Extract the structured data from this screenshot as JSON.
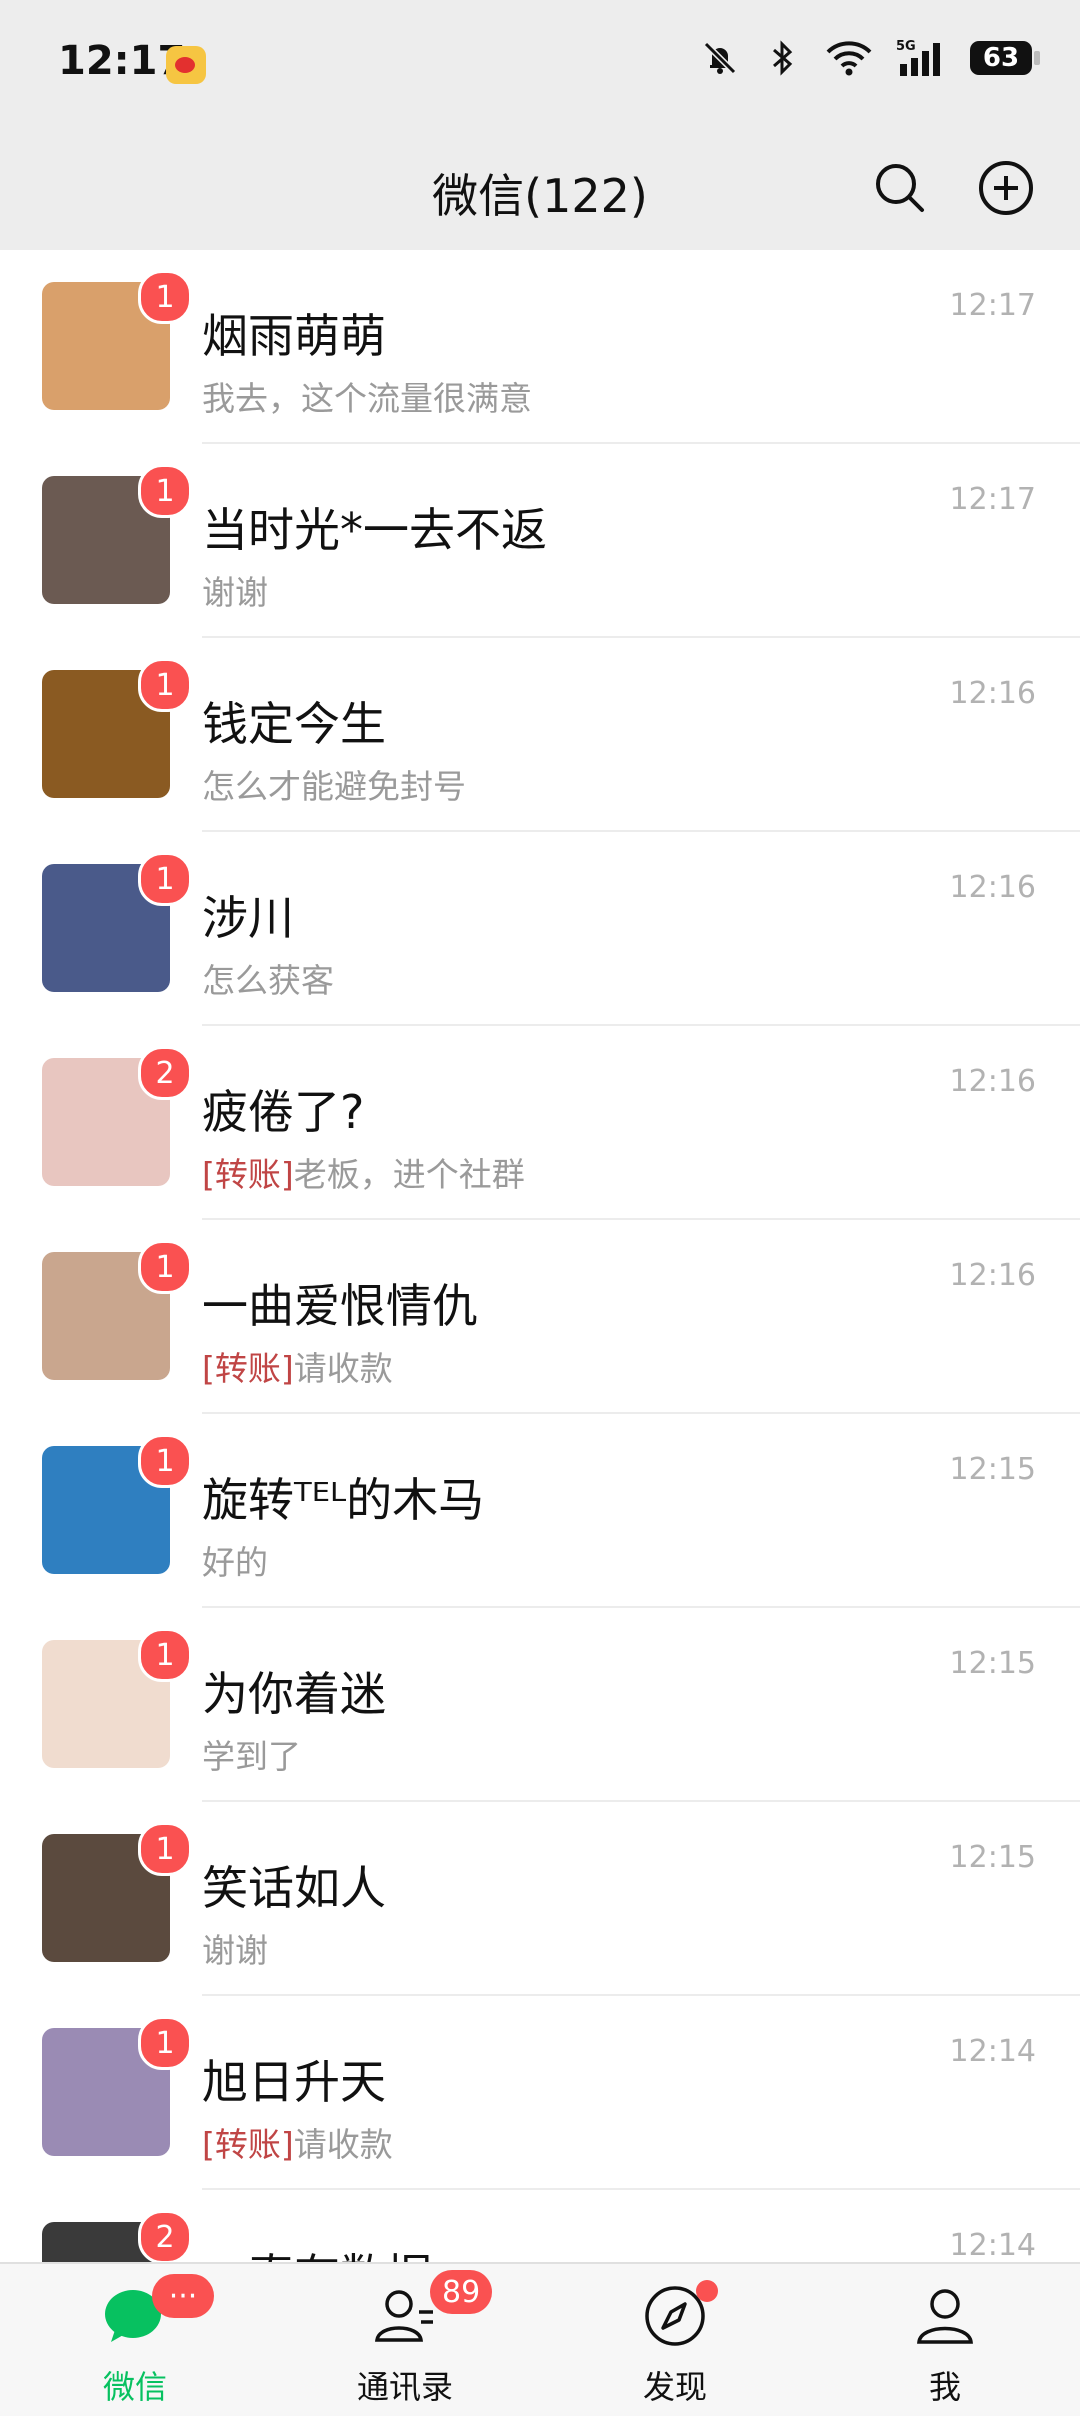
{
  "status_bar": {
    "time": "12:17",
    "battery": "63",
    "icons": [
      "weibo-icon",
      "bell-muted-icon",
      "bluetooth-icon",
      "wifi-icon",
      "signal-5g-icon",
      "battery-icon"
    ]
  },
  "header": {
    "title": "微信(122)",
    "search_icon": "search-icon",
    "add_icon": "add-circle-icon"
  },
  "chats": [
    {
      "name": "烟雨萌萌",
      "preview": "我去，这个流量很满意",
      "tag": "",
      "time": "12:17",
      "badge": "1",
      "avatar_color": "#d9a06b"
    },
    {
      "name": "当时光*一去不返",
      "preview": "谢谢",
      "tag": "",
      "time": "12:17",
      "badge": "1",
      "avatar_color": "#6b5a52"
    },
    {
      "name": "钱定今生",
      "preview": "怎么才能避免封号",
      "tag": "",
      "time": "12:16",
      "badge": "1",
      "avatar_color": "#8a5a22"
    },
    {
      "name": "涉川",
      "preview": "怎么获客",
      "tag": "",
      "time": "12:16",
      "badge": "1",
      "avatar_color": "#4a5a8a"
    },
    {
      "name": "疲倦了?",
      "preview": "老板，进个社群",
      "tag": "[转账]",
      "time": "12:16",
      "badge": "2",
      "avatar_color": "#e8c6c0"
    },
    {
      "name": "一曲爱恨情仇",
      "preview": "请收款",
      "tag": "[转账]",
      "time": "12:16",
      "badge": "1",
      "avatar_color": "#c9a68e"
    },
    {
      "name": "旋转ᵀᴱᴸ的木马",
      "preview": "好的",
      "tag": "",
      "time": "12:15",
      "badge": "1",
      "avatar_color": "#2f7fc0"
    },
    {
      "name": "为你着迷",
      "preview": "学到了",
      "tag": "",
      "time": "12:15",
      "badge": "1",
      "avatar_color": "#f0dccf"
    },
    {
      "name": "笑话如人",
      "preview": "谢谢",
      "tag": "",
      "time": "12:15",
      "badge": "1",
      "avatar_color": "#5b4a3e"
    },
    {
      "name": "旭日升天",
      "preview": "请收款",
      "tag": "[转账]",
      "time": "12:14",
      "badge": "1",
      "avatar_color": "#9a8bb4"
    },
    {
      "name": "一真有数据",
      "preview": "",
      "tag": "",
      "time": "12:14",
      "badge": "2",
      "avatar_color": "#3a3a3a"
    }
  ],
  "tabs": [
    {
      "label": "微信",
      "icon": "chat-bubble-icon",
      "active": true,
      "badge": "···"
    },
    {
      "label": "通讯录",
      "icon": "contacts-icon",
      "active": false,
      "badge": "89"
    },
    {
      "label": "发现",
      "icon": "compass-icon",
      "active": false,
      "badge": ""
    },
    {
      "label": "我",
      "icon": "person-icon",
      "active": false,
      "badge": ""
    }
  ],
  "colors": {
    "accent_green": "#07c160",
    "badge_red": "#fa5151",
    "transfer_tag": "#c04545",
    "header_bg": "#ededed"
  }
}
